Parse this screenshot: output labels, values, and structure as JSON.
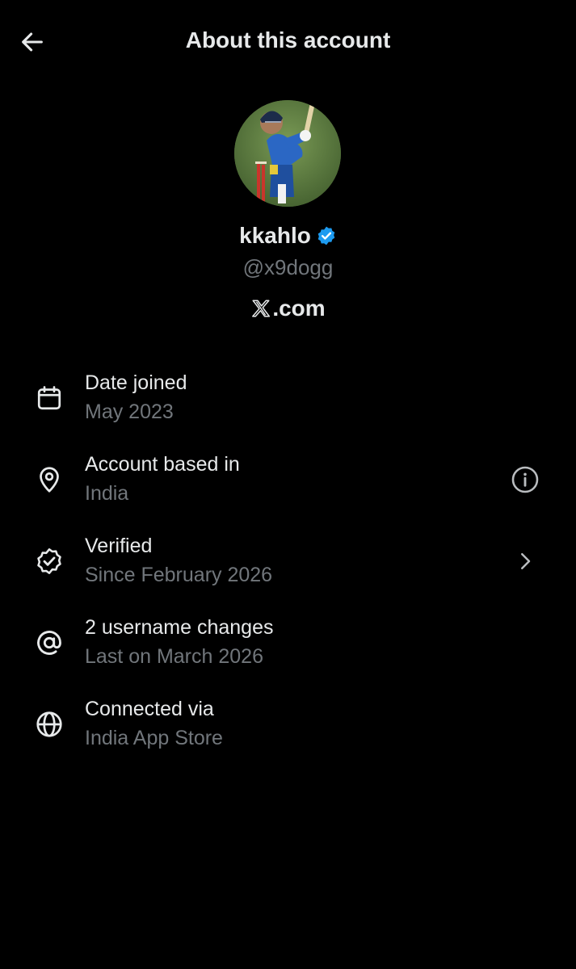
{
  "header": {
    "title": "About this account",
    "back_icon": "arrow-left-icon"
  },
  "profile": {
    "display_name": "kkahlo",
    "verified": true,
    "verified_color": "#1d9bf0",
    "handle": "@x9dogg",
    "site": ".com",
    "site_logo_icon": "x-logo-icon",
    "avatar": "cricket-batsman-photo"
  },
  "info_rows": [
    {
      "icon": "calendar-icon",
      "title": "Date joined",
      "subtitle": "May 2023"
    },
    {
      "icon": "location-pin-icon",
      "title": "Account based in",
      "subtitle": "India",
      "trailing": "info-icon"
    },
    {
      "icon": "verified-badge-outline-icon",
      "title": "Verified",
      "subtitle": "Since February 2026",
      "trailing": "chevron-right-icon"
    },
    {
      "icon": "at-sign-icon",
      "title": "2 username changes",
      "subtitle": "Last on March 2026"
    },
    {
      "icon": "globe-icon",
      "title": "Connected via",
      "subtitle": "India App Store"
    }
  ],
  "colors": {
    "background": "#000000",
    "primary_text": "#e7e9ea",
    "secondary_text": "#71767b",
    "accent": "#1d9bf0"
  }
}
